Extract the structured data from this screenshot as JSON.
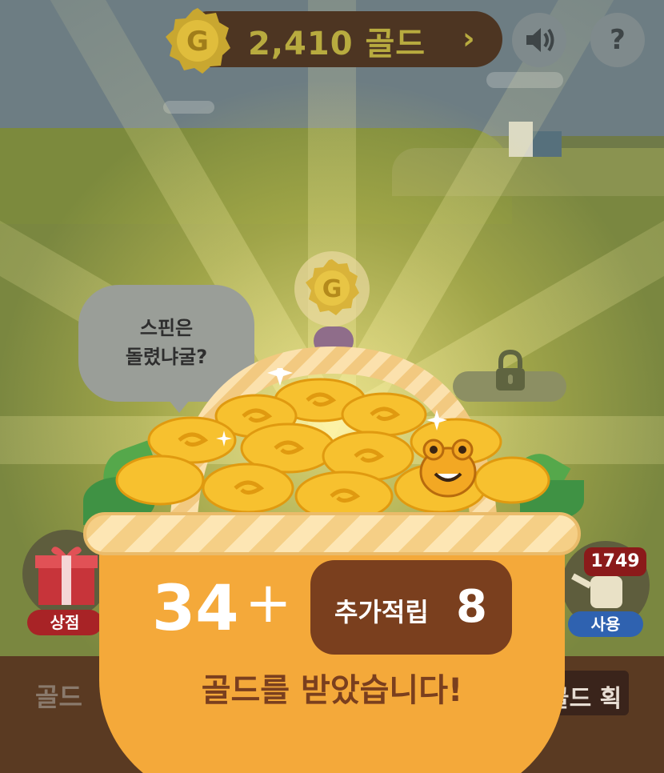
{
  "header": {
    "gold_amount": "2,410 골드",
    "chevron": "›",
    "sound_icon": "speaker-icon",
    "help_label": "?"
  },
  "speech_bubble": {
    "line1": "스핀은",
    "line2": "돌렸냐굴?"
  },
  "shop": {
    "label": "상점"
  },
  "use": {
    "label": "사용",
    "badge": "1749"
  },
  "bottom": {
    "left_text": "골드",
    "right_text": "골드 획"
  },
  "reward": {
    "base": "34",
    "plus": "+",
    "bonus_label": "추가적립",
    "bonus_value": "8",
    "message": "골드를 받았습니다!"
  },
  "colors": {
    "accent_gold": "#f4a93a",
    "brown": "#7a3f1e",
    "shop_red": "#c0282a",
    "use_blue": "#3a78d0"
  }
}
